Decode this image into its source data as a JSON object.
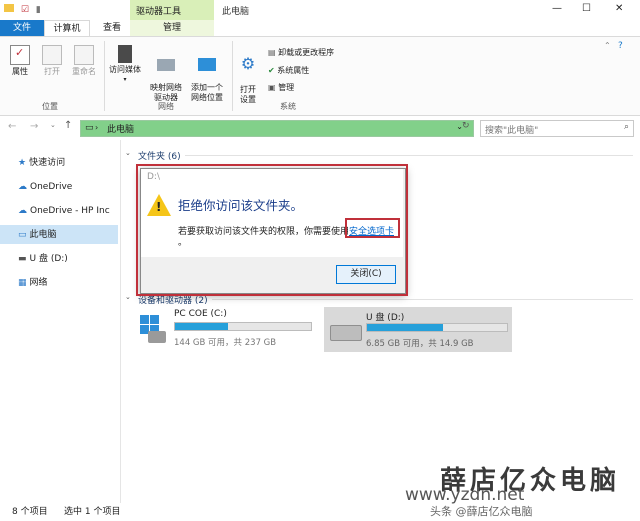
{
  "titlebar": {
    "context_tab": "驱动器工具",
    "window_title": "此电脑",
    "controls": {
      "minimize": "—",
      "maximize": "☐",
      "close": "✕"
    }
  },
  "ribbon_tabs": {
    "file": "文件",
    "computer": "计算机",
    "view": "查看",
    "manage": "管理"
  },
  "ribbon": {
    "location": {
      "label": "位置",
      "properties": "属性",
      "open": "打开",
      "rename": "重命名"
    },
    "network": {
      "label": "网络",
      "media": "访问媒体",
      "map_drive": "映射网络\n驱动器",
      "add_location": "添加一个\n网络位置"
    },
    "system": {
      "label": "系统",
      "open_settings": "打开\n设置",
      "uninstall": "卸载或更改程序",
      "sys_props": "系统属性",
      "manage": "管理"
    }
  },
  "address": {
    "path": "此电脑",
    "search_placeholder": "搜索\"此电脑\""
  },
  "nav": {
    "items": [
      "快速访问",
      "OneDrive",
      "OneDrive - HP Inc",
      "此电脑",
      "U 盘 (D:)",
      "网络"
    ]
  },
  "content": {
    "folders_title": "文件夹 (6)",
    "devices_title": "设备和驱动器 (2)",
    "drives": [
      {
        "name": "PC COE (C:)",
        "space": "144 GB 可用，共 237 GB",
        "used_fraction": 0.39
      },
      {
        "name": "U 盘 (D:)",
        "space": "6.85 GB 可用，共 14.9 GB",
        "used_fraction": 0.54
      }
    ]
  },
  "dialog": {
    "path": "D:\\",
    "title": "拒绝你访问该文件夹。",
    "message": "若要获取访问该文件夹的权限，你需要使用",
    "link": "安全选项卡",
    "period": "。",
    "close_label": "关闭(C)"
  },
  "status": {
    "count": "8 个项目",
    "selected": "选中 1 个项目"
  },
  "watermark": {
    "line1": "薛店亿众电脑",
    "line2": "www.yzdn.net",
    "overlay": "头条 @薛店亿众电脑"
  },
  "colors": {
    "accent": "#1979ca",
    "context_tab": "#d9efb8",
    "address_bar": "#82d08a",
    "highlight": "#c0303a",
    "drive_fill": "#26a0da"
  }
}
